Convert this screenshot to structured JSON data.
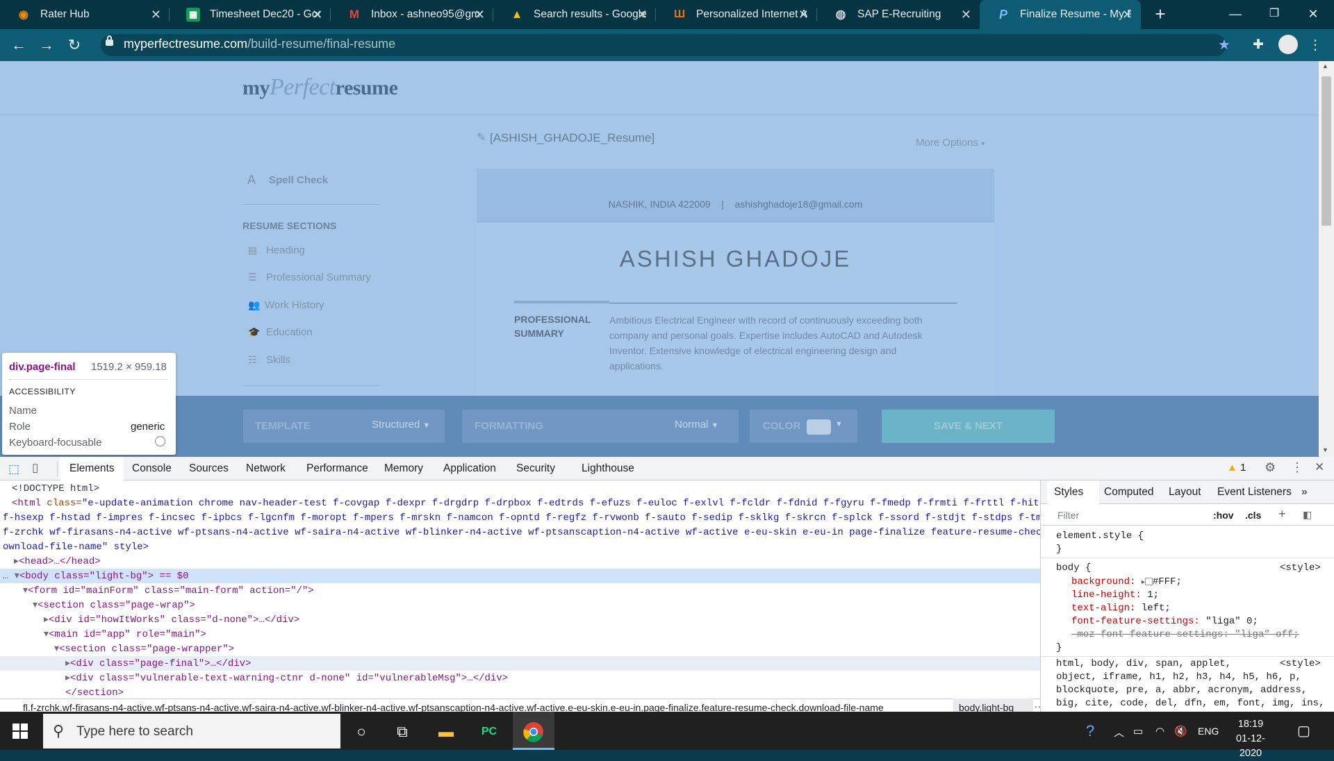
{
  "browser": {
    "tabs": [
      {
        "label": "Rater Hub",
        "icon": "rater-hub-favicon"
      },
      {
        "label": "Timesheet Dec20 - Goo",
        "icon": "google-sheets-favicon"
      },
      {
        "label": "Inbox - ashneo95@gm",
        "icon": "gmail-favicon"
      },
      {
        "label": "Search results - Google",
        "icon": "google-drive-favicon"
      },
      {
        "label": "Personalized Internet A",
        "icon": "personalized-internet-favicon"
      },
      {
        "label": "SAP E-Recruiting",
        "icon": "globe-favicon"
      },
      {
        "label": "Finalize Resume - My P",
        "icon": "myperfectresume-favicon",
        "active": true
      }
    ],
    "url_host": "myperfectresume.com",
    "url_path": "/build-resume/final-resume"
  },
  "page": {
    "logo_my": "my",
    "logo_perfect": "Perfect",
    "logo_resume": "resume",
    "doc_name": "[ASHISH_GHADOJE_Resume]",
    "more_options": "More Options",
    "spell_check": "Spell Check",
    "resume_sections_title": "RESUME SECTIONS",
    "sections": [
      "Heading",
      "Professional Summary",
      "Work History",
      "Education",
      "Skills"
    ],
    "resume": {
      "location": "NASHIK, INDIA 422009",
      "separator": "|",
      "email": "ashishghadoje18@gmail.com",
      "name": "ASHISH GHADOJE",
      "summary_label": "PROFESSIONAL SUMMARY",
      "summary_text": "Ambitious Electrical Engineer with record of continuously exceeding both company and personal goals. Expertise includes AutoCAD and Autodesk Inventor. Extensive knowledge of electrical engineering design and applications."
    },
    "bottom": {
      "template_label": "TEMPLATE",
      "template_value": "Structured",
      "formatting_label": "FORMATTING",
      "formatting_value": "Normal",
      "color_label": "COLOR",
      "save_next": "SAVE & NEXT"
    }
  },
  "tooltip": {
    "selector": "div.page-final",
    "size": "1519.2 × 959.18",
    "section": "ACCESSIBILITY",
    "name_label": "Name",
    "role_label": "Role",
    "role_value": "generic",
    "focus_label": "Keyboard-focusable"
  },
  "devtools": {
    "tabs": [
      "Elements",
      "Console",
      "Sources",
      "Network",
      "Performance",
      "Memory",
      "Application",
      "Security",
      "Lighthouse"
    ],
    "warnings": "1",
    "dom": {
      "doctype": "<!DOCTYPE html>",
      "html_open": "<html",
      "html_class_attr": "class=",
      "html_class_line1": "\"e-update-animation chrome nav-header-test f-covgap f-dexpr f-drgdrp f-drpbox f-edtrds f-efuzs f-euloc f-exlvl f-fcldr f-fdnid f-fgyru f-fmedp f-frmti f-frttl f-hittc",
      "html_class_line2": "f-hsexp f-hstad f-impres f-incsec f-ipbcs f-lgcnfm f-moropt f-mpers f-mrskn f-namcon f-opntd f-regfz f-rvwonb f-sauto f-sedip f-sklkg f-skrcn f-splck f-ssord f-stdjt f-stdps f-tmpfl",
      "html_class_line3": "f-zrchk wf-firasans-n4-active wf-ptsans-n4-active wf-saira-n4-active wf-blinker-n4-active wf-ptsanscaption-n4-active wf-active e-eu-skin e-eu-in page-finalize feature-resume-check d",
      "html_class_line4": "ownload-file-name\" style>",
      "head": "<head>…</head>",
      "body": "<body class=\"light-bg\"> == $0",
      "form": "<form id=\"mainForm\" class=\"main-form\" action=\"/\">",
      "section_wrap": "<section class=\"page-wrap\">",
      "howitworks": "<div id=\"howItWorks\" class=\"d-none\">…</div>",
      "main": "<main id=\"app\" role=\"main\">",
      "section_wrapper": "<section class=\"page-wrapper\">",
      "page_final": "<div class=\"page-final\">…</div>",
      "vulnerable": "<div class=\"vulnerable-text-warning-ctnr d-none\" id=\"vulnerableMsg\">…</div>",
      "section_close": "</section>"
    },
    "breadcrumb": "fl.f-zrchk.wf-firasans-n4-active.wf-ptsans-n4-active.wf-saira-n4-active.wf-blinker-n4-active.wf-ptsanscaption-n4-active.wf-active.e-eu-skin.e-eu-in.page-finalize.feature-resume-check.download-file-name",
    "breadcrumb_body": "body.light-bg",
    "styles_tabs": [
      "Styles",
      "Computed",
      "Layout",
      "Event Listeners"
    ],
    "filter_placeholder": "Filter",
    "hov": ":hov",
    "cls": ".cls",
    "css": {
      "element_style": "element.style {",
      "close": "}",
      "body_sel": "body {",
      "style_src": "<style>",
      "bg_prop": "background:",
      "bg_val": "#FFF;",
      "lh_prop": "line-height:",
      "lh_val": "1;",
      "ta_prop": "text-align:",
      "ta_val": "left;",
      "ffs_prop": "font-feature-settings:",
      "ffs_val": "\"liga\" 0;",
      "moz_line": "-moz-font-feature-settings: \"liga\" off;",
      "reset_line1": "html, body, div, span, applet,",
      "reset_line2": "object, iframe, h1, h2, h3, h4, h5, h6, p,",
      "reset_line3": "blockquote, pre, a, abbr, acronym, address,",
      "reset_line4": "big, cite, code, del, dfn, em, font, img, ins,"
    }
  },
  "taskbar": {
    "search_placeholder": "Type here to search",
    "lang": "ENG",
    "time": "18:19",
    "date": "01-12-2020"
  }
}
